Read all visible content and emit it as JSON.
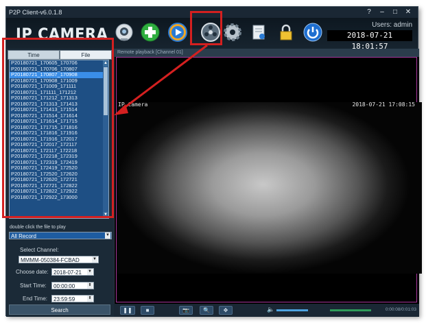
{
  "window": {
    "title": "P2P Client-v6.0.1.8",
    "ctrl_help": "?",
    "ctrl_min": "‒",
    "ctrl_max": "□",
    "ctrl_close": "✕"
  },
  "header": {
    "logo": "IP CAMERA",
    "users": "Users: admin",
    "clock": "2018-07-21  18:01:57"
  },
  "toolbar": {
    "icons": [
      "camera-icon",
      "add-icon",
      "play-icon",
      "reel-icon",
      "gear-icon",
      "report-icon",
      "lock-icon",
      "power-icon"
    ]
  },
  "left_panel": {
    "tabs": [
      "Time",
      "File"
    ],
    "files": [
      "P20180721_170605_170706",
      "P20180721_170706_170807",
      "P20180721_170807_170908",
      "P20180721_170908_171009",
      "P20180721_171009_171111",
      "P20180721_171111_171212",
      "P20180721_171212_171313",
      "P20180721_171313_171413",
      "P20180721_171413_171514",
      "P20180721_171514_171614",
      "P20180721_171614_171715",
      "P20180721_171715_171816",
      "P20180721_171816_171916",
      "P20180721_171916_172017",
      "P20180721_172017_172117",
      "P20180721_172117_172218",
      "P20180721_172218_172319",
      "P20180721_172319_172419",
      "P20180721_172419_172520",
      "P20180721_172520_172620",
      "P20180721_172620_172721",
      "P20180721_172721_172822",
      "P20180721_172822_172922",
      "P20180721_172922_173000"
    ],
    "selected_index": 2,
    "hint": "double click the file to play",
    "record_filter": "All Record",
    "select_channel_label": "Select Channel:",
    "channel": "MMMM-050384-FCBAD",
    "choose_date_label": "Choose date:",
    "date": "2018-07-21",
    "start_time_label": "Start Time:",
    "start_time": "00:00:00",
    "end_time_label": "End Time:",
    "end_time": "23:59:59",
    "search_label": "Search"
  },
  "video": {
    "header": "Remote playback [Channel 01]",
    "cam_title": "IP Camera",
    "cam_time": "2018-07-21 17:08:15",
    "timecode": "0:00:08/0:01:03"
  },
  "colors": {
    "annotation": "#d42020",
    "accent": "#3a8ee8"
  }
}
